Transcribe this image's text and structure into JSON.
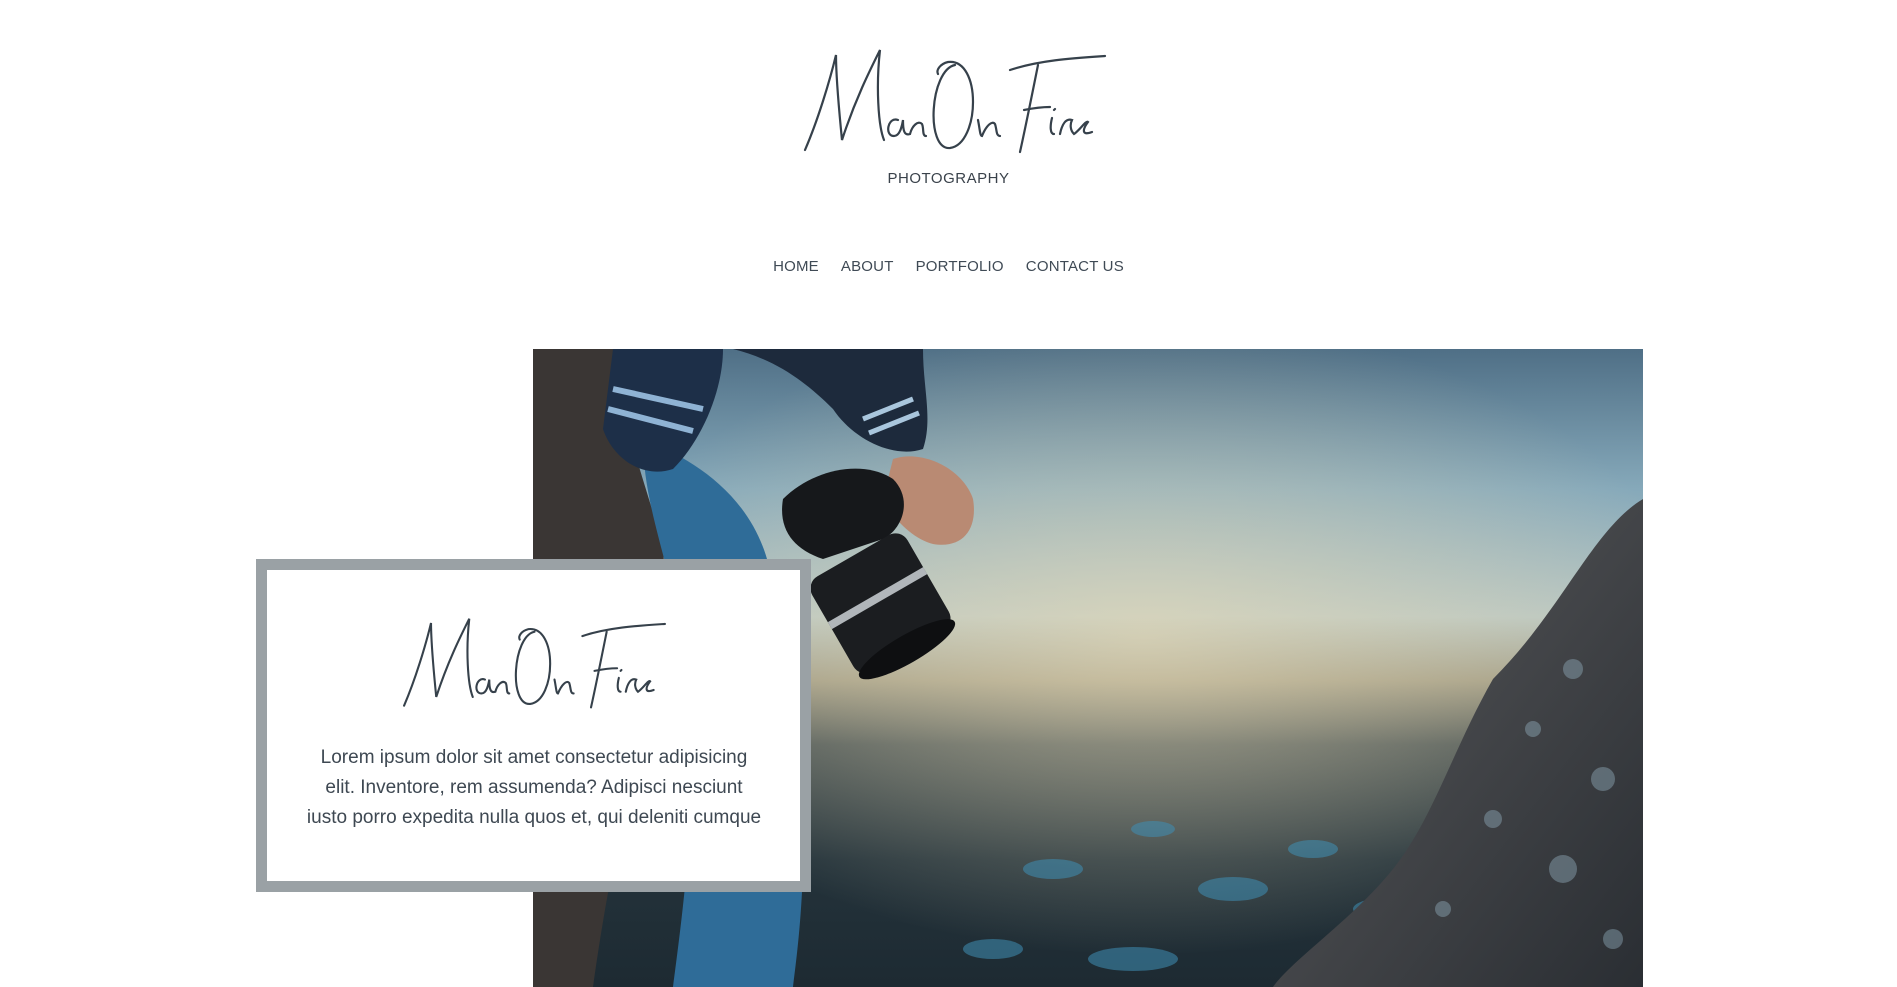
{
  "brand": {
    "logo_text": "Man On Fire",
    "subtitle": "PHOTOGRAPHY"
  },
  "nav": {
    "items": [
      {
        "label": "HOME"
      },
      {
        "label": "ABOUT"
      },
      {
        "label": "PORTFOLIO"
      },
      {
        "label": "CONTACT US"
      }
    ]
  },
  "hero": {
    "image_subject": "photographer holding camera on rocky cliff at dusk",
    "card": {
      "logo_text": "Man On Fire",
      "body": "Lorem ipsum dolor sit amet consectetur adipisicing elit. Inventore, rem assumenda? Adipisci nesciunt iusto porro expedita nulla quos et, qui deleniti cumque"
    }
  },
  "colors": {
    "text": "#3c4650",
    "card_border": "#9aa1a5",
    "background": "#ffffff"
  }
}
